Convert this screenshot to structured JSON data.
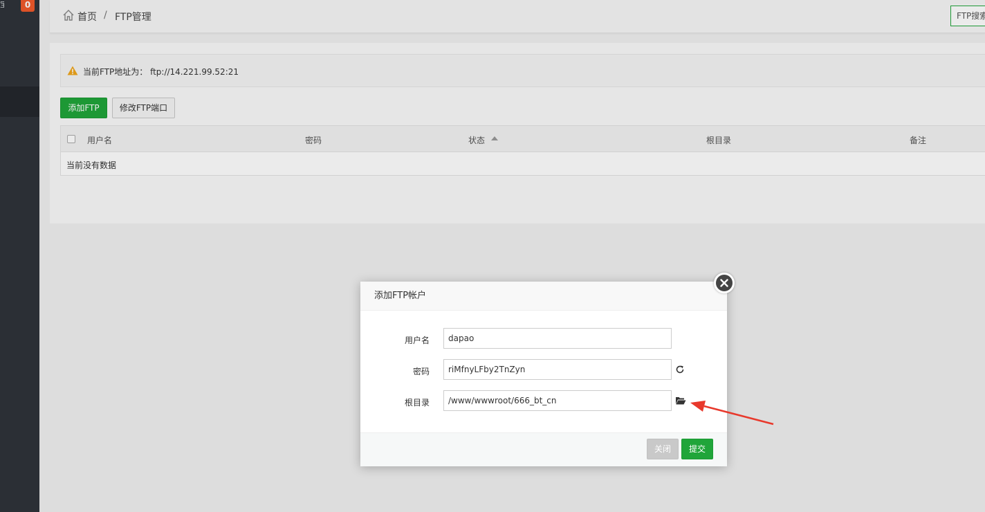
{
  "sidebar": {
    "badge_count": "0",
    "fragment_text": "宝"
  },
  "breadcrumb": {
    "home": "首页",
    "separator": "/",
    "current": "FTP管理"
  },
  "search_button": "FTP搜索",
  "notice": {
    "text": "当前FTP地址为： ftp://14.221.99.52:21"
  },
  "toolbar": {
    "add_label": "添加FTP",
    "modify_port_label": "修改FTP端口"
  },
  "table": {
    "columns": [
      "用户名",
      "密码",
      "状态",
      "根目录",
      "备注"
    ],
    "empty_text": "当前没有数据"
  },
  "modal": {
    "title": "添加FTP帐户",
    "fields": {
      "username": {
        "label": "用户名",
        "value": "dapao"
      },
      "password": {
        "label": "密码",
        "value": "riMfnyLFby2TnZyn"
      },
      "root": {
        "label": "根目录",
        "value": "/www/wwwroot/666_bt_cn"
      }
    },
    "close_label": "关闭",
    "submit_label": "提交"
  },
  "colors": {
    "accent": "#20a53a",
    "sidebar": "#2f343a",
    "badge": "#f05a2b",
    "annotation": "#e8392c"
  }
}
